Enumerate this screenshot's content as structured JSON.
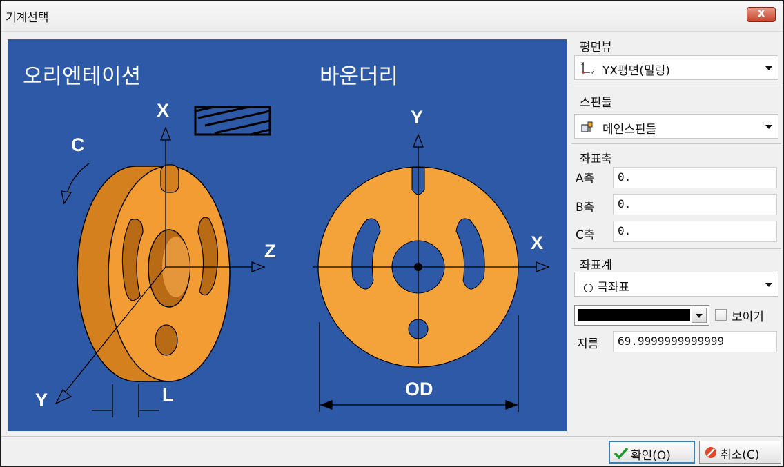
{
  "window": {
    "title": "기계선택",
    "close_label": "X"
  },
  "canvas": {
    "orientation_label": "오리엔테이션",
    "boundary_label": "바운더리",
    "orientation_axes": {
      "x": "X",
      "y": "Y",
      "z": "Z",
      "c": "C",
      "l": "L"
    },
    "boundary_axes": {
      "x": "X",
      "y": "Y",
      "od": "OD"
    }
  },
  "panel": {
    "plane_view": {
      "title": "평면뷰",
      "selected": "YX평면(밀링)",
      "icon": "axis-icon"
    },
    "spindle": {
      "title": "스핀들",
      "selected": "메인스핀들",
      "icon": "spindle-icon"
    },
    "coord_axes": {
      "title": "좌표축",
      "rows": [
        {
          "label": "A축",
          "value": "0."
        },
        {
          "label": "B축",
          "value": "0."
        },
        {
          "label": "C축",
          "value": "0."
        }
      ]
    },
    "coord_system": {
      "title": "좌표계",
      "selected": "○ 극좌표",
      "color_value": "#000000",
      "show_label": "보이기",
      "show_checked": false,
      "diameter_label": "지름",
      "diameter_value": "69.9999999999999"
    }
  },
  "buttons": {
    "ok_label": "확인(O)",
    "cancel_label": "취소(C)"
  }
}
